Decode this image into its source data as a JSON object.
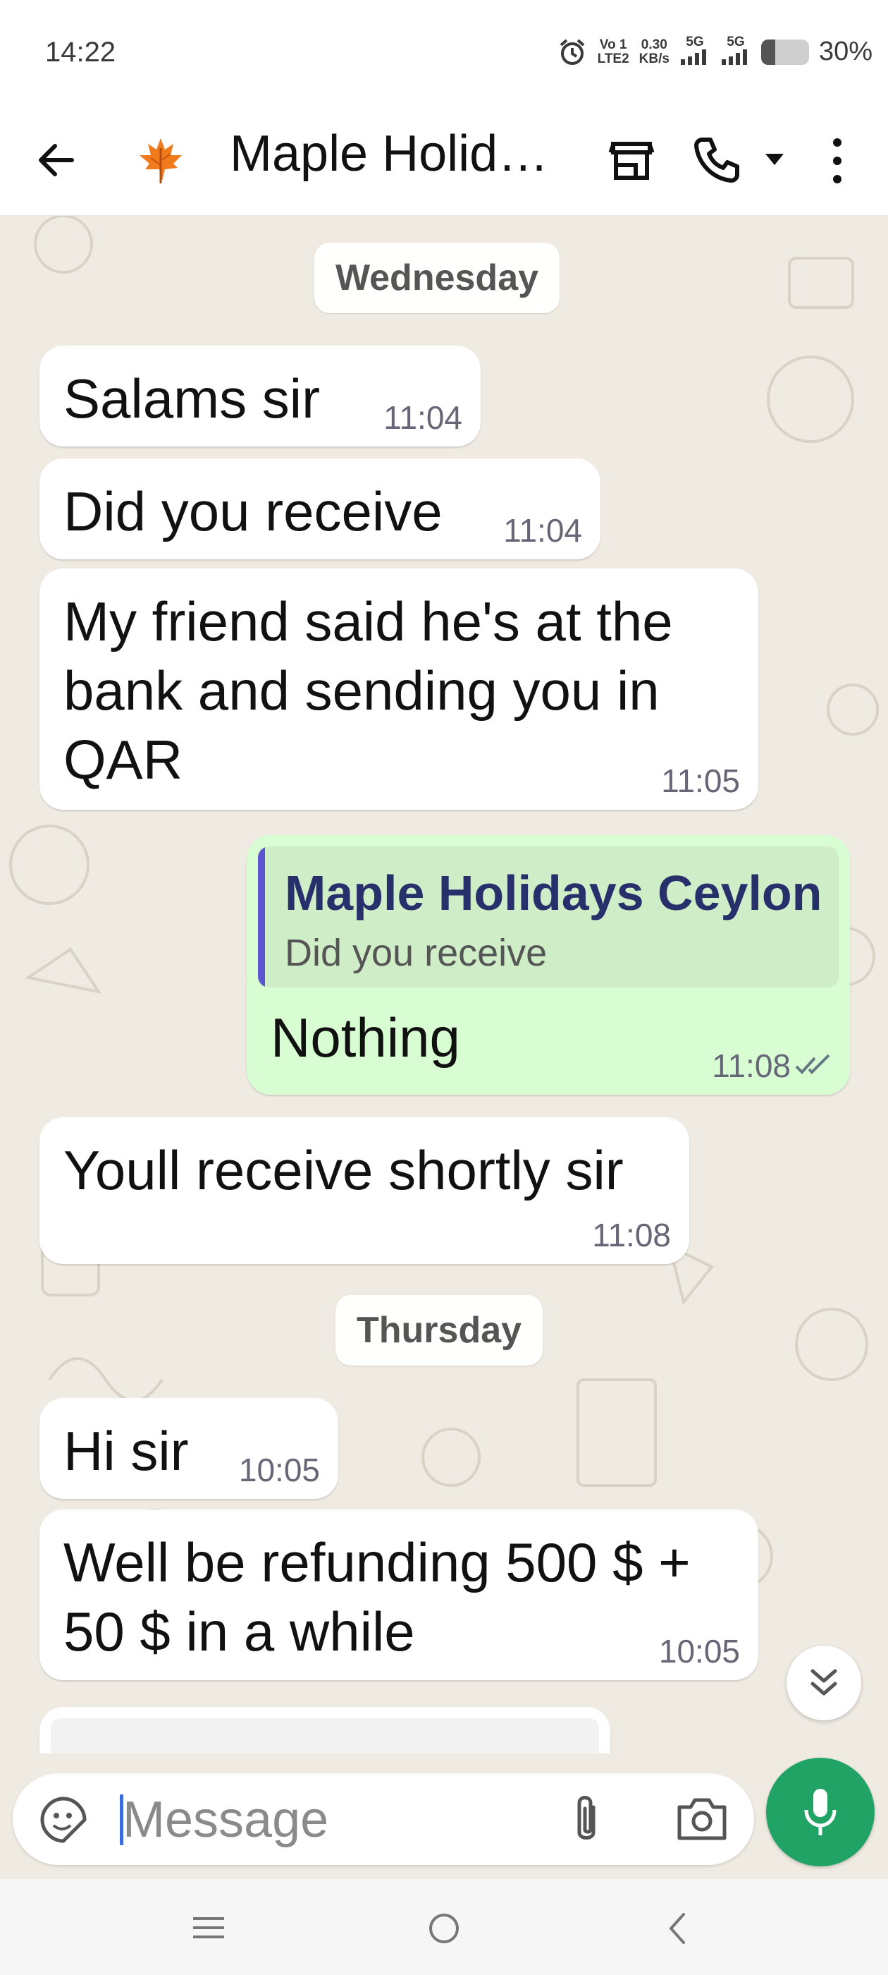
{
  "status_bar": {
    "time": "14:22",
    "network_1": [
      "Vo 1",
      "LTE2"
    ],
    "speed": [
      "0.30",
      "KB/s"
    ],
    "net_5g_1": "5G",
    "net_5g_2": "5G",
    "battery_percent": "30%",
    "battery_level": 0.3
  },
  "header": {
    "chat_name": "Maple Holidays Ceylon",
    "icons": [
      "back-arrow-icon",
      "maple-leaf-avatar",
      "store-icon",
      "phone-icon",
      "dropdown-icon",
      "more-options-icon"
    ]
  },
  "chat": {
    "day_1": "Wednesday",
    "day_2": "Thursday",
    "messages": [
      {
        "direction": "in",
        "text": "Salams sir",
        "time": "11:04"
      },
      {
        "direction": "in",
        "text": "Did you receive",
        "time": "11:04"
      },
      {
        "direction": "in",
        "text": [
          "My friend said he's at the",
          "bank and sending you in",
          "QAR"
        ],
        "time": "11:05"
      },
      {
        "direction": "out",
        "quote_name": "Maple Holidays Ceylon",
        "quote_text": "Did you receive",
        "text": "Nothing",
        "time": "11:08",
        "status": "read"
      },
      {
        "direction": "in",
        "text": "Youll receive shortly sir",
        "time": "11:08"
      },
      {
        "direction": "in",
        "text": "Hi sir",
        "time": "10:05"
      },
      {
        "direction": "in",
        "text": [
          "Well be refunding 500 $ +",
          "50 $ in a while"
        ],
        "time": "10:05"
      }
    ]
  },
  "composer": {
    "placeholder": "Message",
    "value": ""
  },
  "colors": {
    "incoming_bubble": "#ffffff",
    "outgoing_bubble": "#d9fdd3",
    "mic_button": "#21a366",
    "read_tick": "#667781",
    "quote_bar": "#5b55d0"
  }
}
